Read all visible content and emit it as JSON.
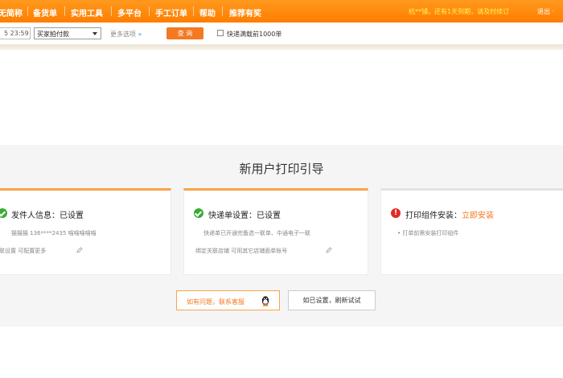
{
  "nav": {
    "items": [
      "无简称",
      "备货单",
      "实用工具",
      "多平台",
      "手工订单",
      "帮助",
      "推荐有奖"
    ],
    "notice": "杭**铺，还有1天到期，请及时续订",
    "logout": "退出 ·"
  },
  "toolbar": {
    "date_value": "5 23:59",
    "select_value": "买家拍付款",
    "more_link": "更多选项",
    "more_arrows": "»",
    "query_label": "查 询",
    "quick_label": "快递满载前1000单"
  },
  "guide": {
    "title": "新用户打印引导",
    "cards": [
      {
        "heading": "发件人信息：已设置",
        "line1": "猫猫猫 136****2435 喵喵喵喵喵",
        "line2": "联设置 可配置更多"
      },
      {
        "heading": "快递单设置：已设置",
        "line1": "快递单已开通完备选一联单、中通电子一联",
        "line2": "绑定关联店铺 可用其它店铺面单账号"
      },
      {
        "heading_prefix": "打印组件安装：",
        "heading_link": "立即安装",
        "line1": "• 打单前需安装打印组件"
      }
    ],
    "help_button": "如有问题，联系客服",
    "retry_button": "如已设置，刷新试试"
  },
  "colors": {
    "nav_bg": "#ff8400",
    "accent": "#f47920",
    "ok": "#3aaa35",
    "error": "#e02e24",
    "notice": "#fff35a"
  }
}
